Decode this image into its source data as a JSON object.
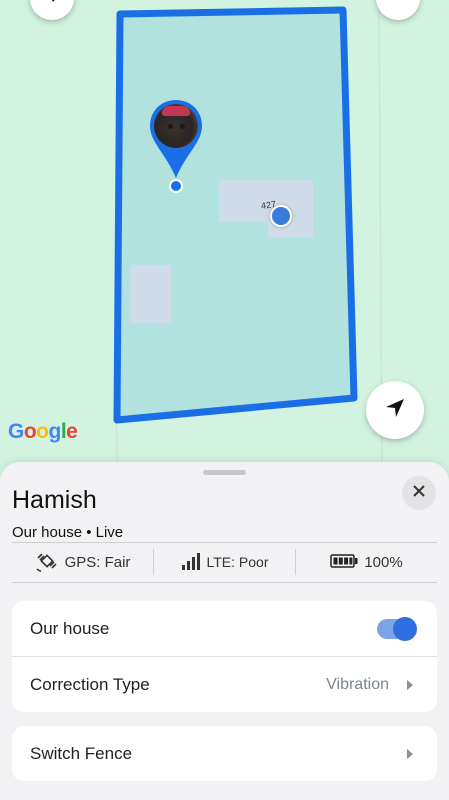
{
  "map": {
    "logo": "Google",
    "house_number": "427",
    "icons": [
      "back-icon",
      "layers-icon",
      "navigation-arrow-icon",
      "pet-location-pin-icon",
      "user-location-icon"
    ],
    "colors": {
      "fence": "#1a6fe6",
      "fence_fill": "#b2e2dd",
      "ground": "#d3f3e1",
      "building": "#d0dbe9"
    }
  },
  "sheet": {
    "pet_name": "Hamish",
    "subtitle": "Our house • Live",
    "status": {
      "gps": {
        "label": "GPS: Fair",
        "icon": "satellite-icon"
      },
      "lte": {
        "label": "LTE: Poor",
        "icon": "signal-bars-icon"
      },
      "battery": {
        "label": "100%",
        "icon": "battery-icon",
        "level": 1.0
      }
    },
    "settings": {
      "fence_label": "Our house",
      "fence_enabled": true,
      "correction_label": "Correction Type",
      "correction_value": "Vibration"
    },
    "switch_fence_label": "Switch Fence"
  },
  "colors": {
    "accent": "#2f6ee0",
    "sheet_bg": "#f2f2f4"
  }
}
